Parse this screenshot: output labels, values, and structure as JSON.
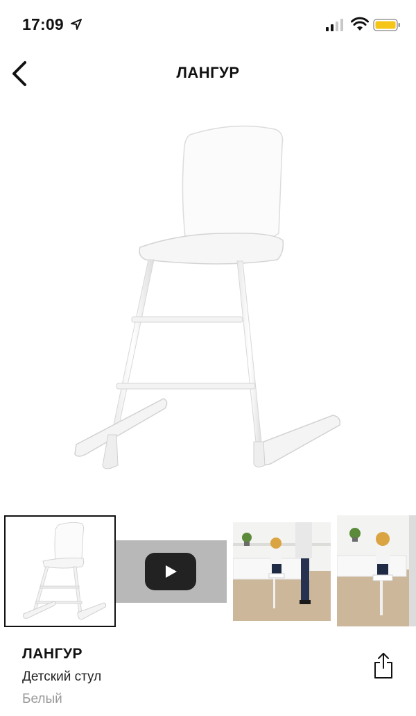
{
  "status_bar": {
    "time": "17:09",
    "icons": [
      "location-arrow-icon",
      "signal-icon",
      "wifi-icon",
      "battery-icon"
    ],
    "battery_color": "#f5c518"
  },
  "nav": {
    "title": "ЛАНГУР",
    "back_icon": "chevron-left-icon"
  },
  "gallery": {
    "main_image": "white-child-chair",
    "thumbnails": [
      {
        "kind": "image",
        "subject": "white-child-chair",
        "selected": true
      },
      {
        "kind": "video",
        "subject": "video-preview",
        "selected": false
      },
      {
        "kind": "image",
        "subject": "girl-at-kitchen-table",
        "selected": false
      },
      {
        "kind": "image",
        "subject": "girl-at-kitchen-table-closeup",
        "selected": false
      }
    ]
  },
  "product": {
    "name": "ЛАНГУР",
    "type": "Детский стул",
    "color": "Белый",
    "share_icon": "share-icon"
  },
  "colors": {
    "text": "#111111",
    "secondary_text": "#999999",
    "background": "#ffffff"
  }
}
